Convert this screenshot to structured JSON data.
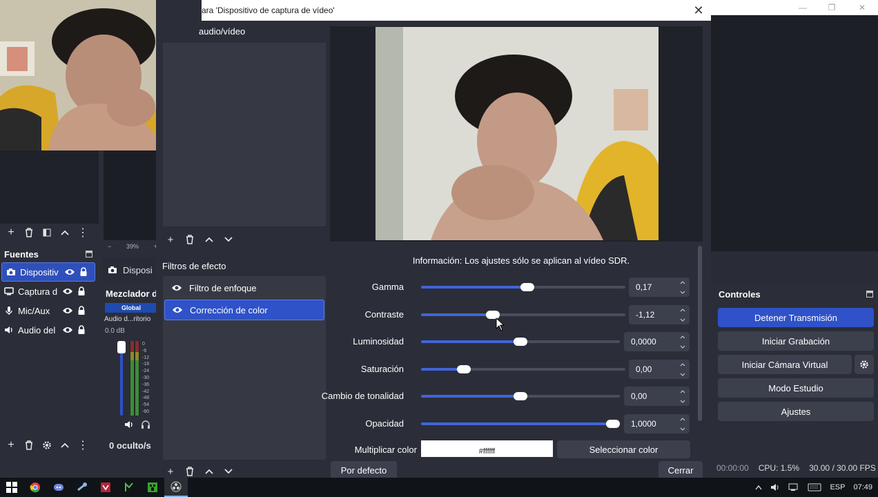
{
  "main_window": {
    "controls_min": "—",
    "controls_max": "❐",
    "controls_close": "✕"
  },
  "scenes_toolbar": {
    "add": "+",
    "remove": "🗑",
    "filter": "▤",
    "up": "⌃",
    "more": "⋮"
  },
  "preview": {
    "zoom_minus": "−",
    "zoom_value": "39%",
    "zoom_plus": "+"
  },
  "sources": {
    "title": "Fuentes",
    "items": [
      {
        "label": "Dispositivo de captura de vídeo",
        "short": "Dispositiv",
        "icon": "camera-icon",
        "selected": true
      },
      {
        "label": "Captura de pantalla",
        "short": "Captura d",
        "icon": "monitor-icon",
        "selected": false
      },
      {
        "label": "Mic/Aux",
        "short": "Mic/Aux",
        "icon": "microphone-icon",
        "selected": false
      },
      {
        "label": "Audio del escritorio",
        "short": "Audio del",
        "icon": "speaker-icon",
        "selected": false
      }
    ]
  },
  "source_bar": {
    "label": "Disposi"
  },
  "mixer": {
    "title": "Mezclador d",
    "global": "Global",
    "track": "Audio d...ritorio",
    "db": "0.0 dB",
    "scale": [
      "0",
      "-6",
      "-12",
      "-18",
      "-24",
      "-30",
      "-36",
      "-42",
      "-48",
      "-54",
      "-60"
    ],
    "level": 0.95,
    "hidden_label": "0 oculto/s"
  },
  "controls": {
    "title": "Controles",
    "buttons": [
      "Detener Transmisión",
      "Iniciar Grabación",
      "Iniciar Cámara Virtual",
      "Modo Estudio",
      "Ajustes"
    ]
  },
  "status": {
    "time": "00:00:00",
    "cpu": "CPU: 1.5%",
    "fps": "30.00 / 30.00 FPS"
  },
  "dialog": {
    "title": "ara 'Dispositivo de captura de vídeo'",
    "close": "✕",
    "av_header": "audio/vídeo",
    "effects_header": "Filtros de efecto",
    "effects": [
      {
        "label": "Filtro de enfoque",
        "selected": false
      },
      {
        "label": "Corrección de color",
        "selected": true
      }
    ],
    "info": "Información: Los ajustes sólo se aplican al vídeo SDR.",
    "properties": [
      {
        "label": "Gamma",
        "value": "0,17",
        "level": 0.52
      },
      {
        "label": "Contraste",
        "value": "-1,12",
        "level": 0.34
      },
      {
        "label": "Luminosidad",
        "value": "0,0000",
        "level": 0.5
      },
      {
        "label": "Saturación",
        "value": "0,00",
        "level": 0.19
      },
      {
        "label": "Cambio de tonalidad",
        "value": "0,00",
        "level": 0.5
      },
      {
        "label": "Opacidad",
        "value": "1,0000",
        "level": 1.0
      }
    ],
    "multiply_label": "Multiplicar color",
    "multiply_value": "#ffffff",
    "select_color": "Seleccionar color",
    "default_button": "Por defecto",
    "close_button": "Cerrar"
  },
  "taskbar": {
    "apps": [
      "windows-start-icon",
      "chrome-icon",
      "discord-icon",
      "steam-icon",
      "app-red-icon",
      "app-green-icon",
      "minecraft-icon",
      "obs-icon"
    ],
    "lang": "ESP",
    "clock": "07:49"
  }
}
